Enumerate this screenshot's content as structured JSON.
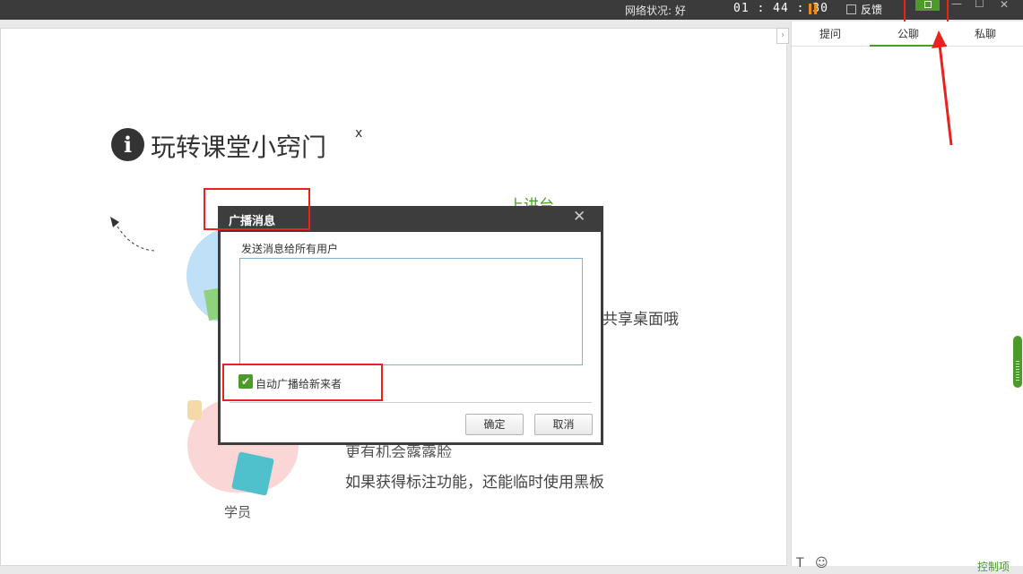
{
  "titlebar": {
    "network_status": "网络状况:  好",
    "timer": "01 : 44 : 30",
    "feedback_label": "反馈",
    "pause_color": "#f08a1c"
  },
  "stage": {
    "tips_title": "玩转课堂小窍门",
    "green_title": "上讲台",
    "share_text": "共享桌面哦",
    "line_a": "更有机会露露脸",
    "line_b": "如果获得标注功能，还能临时使用黑板",
    "student_caption": "学员"
  },
  "panel": {
    "tabs": [
      {
        "label": "提问"
      },
      {
        "label": "公聊"
      },
      {
        "label": "私聊"
      }
    ],
    "active_tab": "公聊",
    "bottom_link": "控制项"
  },
  "dialog": {
    "title": "广播消息",
    "close_glyph": "✕",
    "label": "发送消息给所有用户",
    "textarea_value": "",
    "checkbox_checked": true,
    "checkbox_label": "自动广播给新来者",
    "ok_label": "确定",
    "cancel_label": "取消"
  },
  "colors": {
    "accent": "#4c9a2a",
    "annotation": "#e8231d",
    "titlebar_bg": "#3b3b3b"
  },
  "icons": [
    "info-icon",
    "pause-icon",
    "feedback-icon",
    "broadcast-icon",
    "minimize-icon",
    "maximize-icon",
    "close-icon",
    "collapse-arrow-icon",
    "check-icon",
    "text-format-icon",
    "emoji-icon"
  ]
}
